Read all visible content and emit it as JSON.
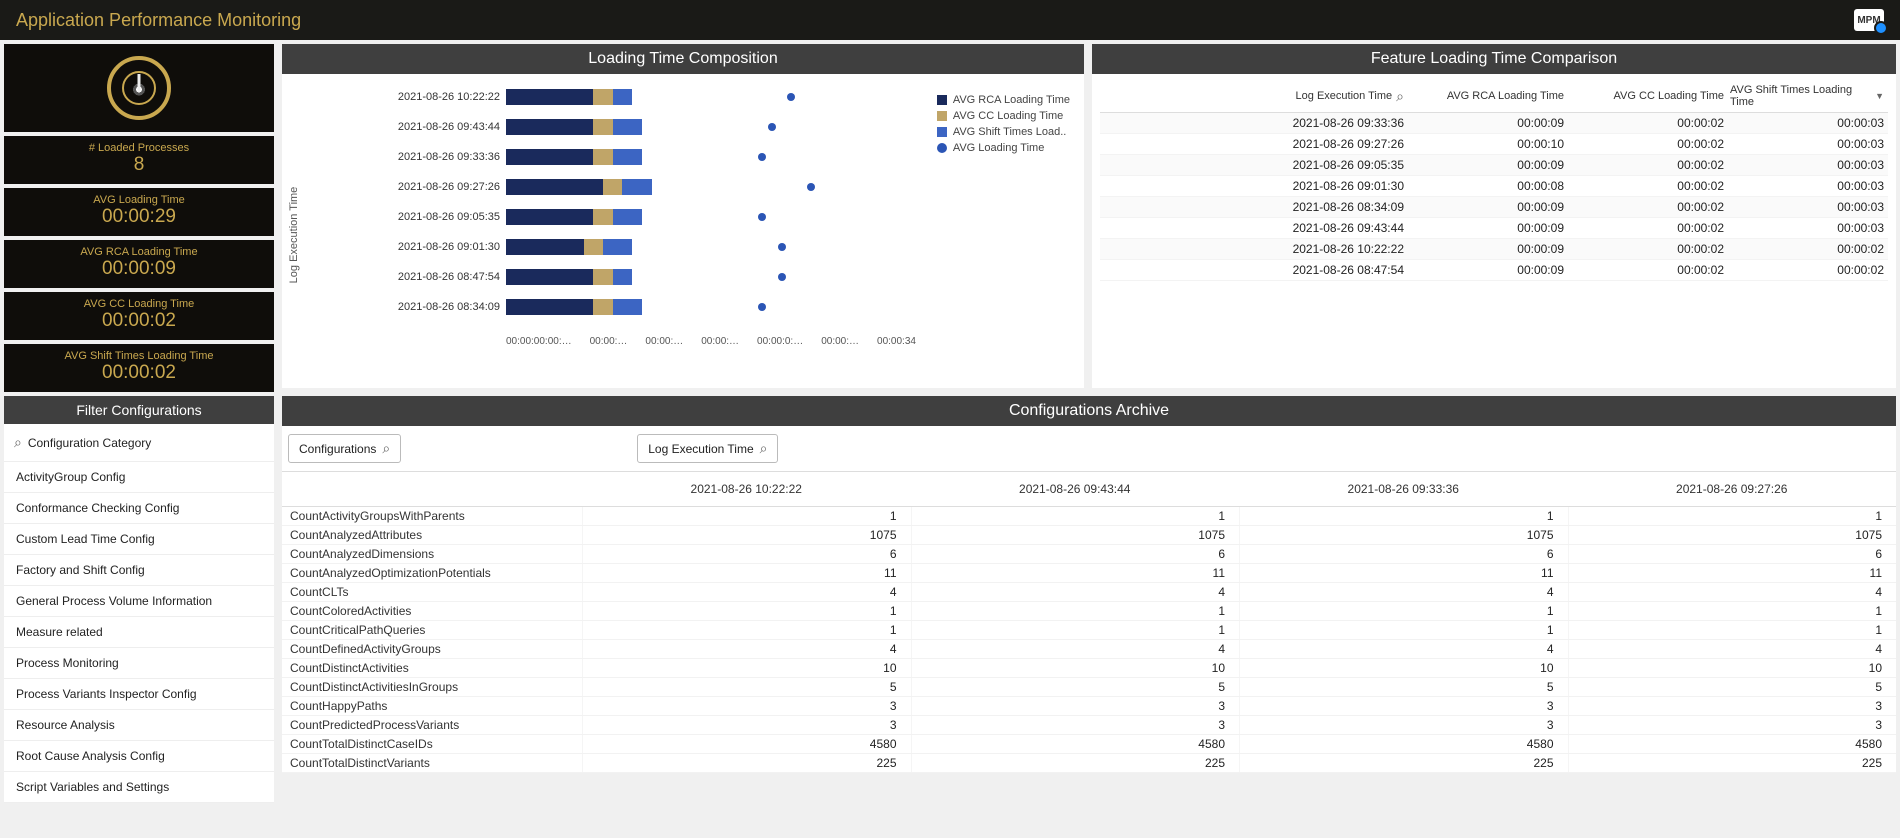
{
  "header": {
    "title": "Application Performance Monitoring",
    "logo_text": "MPM"
  },
  "kpis": [
    {
      "label": "# Loaded Processes",
      "value": "8"
    },
    {
      "label": "AVG Loading Time",
      "value": "00:00:29"
    },
    {
      "label": "AVG RCA Loading Time",
      "value": "00:00:09"
    },
    {
      "label": "AVG CC Loading Time",
      "value": "00:00:02"
    },
    {
      "label": "AVG Shift Times Loading Time",
      "value": "00:00:02"
    }
  ],
  "chart_panel": {
    "title": "Loading Time Composition",
    "y_axis": "Log Execution Time",
    "legend": [
      {
        "label": "AVG   RCA Loading Time",
        "color": "#1a2a5c"
      },
      {
        "label": "AVG   CC Loading Time",
        "color": "#c0a568"
      },
      {
        "label": "AVG   Shift Times Load..",
        "color": "#3c65c3"
      },
      {
        "label": "AVG   Loading Time",
        "shape": "dot",
        "color": "#2b55b5"
      }
    ],
    "x_ticks": [
      "00:00:00:00:…",
      "00:00:…",
      "00:00:…",
      "00:00:…",
      "00:00:0:…",
      "00:00:…",
      "00:00:34"
    ]
  },
  "chart_data": {
    "type": "bar",
    "orientation": "horizontal",
    "stacked": true,
    "y_axis_label": "Log Execution Time",
    "x_axis_label": "",
    "xlim": [
      "00:00:00",
      "00:00:34"
    ],
    "categories": [
      "2021-08-26 10:22:22",
      "2021-08-26 09:43:44",
      "2021-08-26 09:33:36",
      "2021-08-26 09:27:26",
      "2021-08-26 09:05:35",
      "2021-08-26 09:01:30",
      "2021-08-26 08:47:54",
      "2021-08-26 08:34:09"
    ],
    "series": [
      {
        "name": "AVG RCA Loading Time",
        "color": "#1a2a5c",
        "values_seconds": [
          9,
          9,
          9,
          10,
          9,
          8,
          9,
          9
        ]
      },
      {
        "name": "AVG CC Loading Time",
        "color": "#c0a568",
        "values_seconds": [
          2,
          2,
          2,
          2,
          2,
          2,
          2,
          2
        ]
      },
      {
        "name": "AVG Shift Times Loading Time",
        "color": "#3c65c3",
        "values_seconds": [
          2,
          3,
          3,
          3,
          3,
          3,
          2,
          3
        ]
      }
    ],
    "point_series": {
      "name": "AVG Loading Time",
      "color": "#2b55b5",
      "values_seconds": [
        29,
        27,
        26,
        31,
        26,
        28,
        28,
        26
      ]
    }
  },
  "feature_table": {
    "title": "Feature Loading Time Comparison",
    "columns": [
      "Log Execution Time",
      "AVG RCA Loading Time",
      "AVG CC Loading Time",
      "AVG Shift Times Loading Time"
    ],
    "sort_col": 3,
    "sort_dir": "desc",
    "rows": [
      [
        "2021-08-26 09:33:36",
        "00:00:09",
        "00:00:02",
        "00:00:03"
      ],
      [
        "2021-08-26 09:27:26",
        "00:00:10",
        "00:00:02",
        "00:00:03"
      ],
      [
        "2021-08-26 09:05:35",
        "00:00:09",
        "00:00:02",
        "00:00:03"
      ],
      [
        "2021-08-26 09:01:30",
        "00:00:08",
        "00:00:02",
        "00:00:03"
      ],
      [
        "2021-08-26 08:34:09",
        "00:00:09",
        "00:00:02",
        "00:00:03"
      ],
      [
        "2021-08-26 09:43:44",
        "00:00:09",
        "00:00:02",
        "00:00:03"
      ],
      [
        "2021-08-26 10:22:22",
        "00:00:09",
        "00:00:02",
        "00:00:02"
      ],
      [
        "2021-08-26 08:47:54",
        "00:00:09",
        "00:00:02",
        "00:00:02"
      ]
    ]
  },
  "sidebar": {
    "title": "Filter Configurations",
    "search_label": "Configuration Category",
    "items": [
      "ActivityGroup Config",
      "Conformance Checking Config",
      "Custom Lead Time Config",
      "Factory and Shift Config",
      "General Process Volume Information",
      "Measure related",
      "Process Monitoring",
      "Process Variants Inspector Config",
      "Resource Analysis",
      "Root Cause Analysis Config",
      "Script Variables and Settings"
    ]
  },
  "archive": {
    "title": "Configurations Archive",
    "filters": [
      "Configurations",
      "Log Execution Time"
    ],
    "columns": [
      "",
      "2021-08-26 10:22:22",
      "2021-08-26 09:43:44",
      "2021-08-26 09:33:36",
      "2021-08-26 09:27:26"
    ],
    "rows": [
      [
        "CountActivityGroupsWithParents",
        "1",
        "1",
        "1",
        "1"
      ],
      [
        "CountAnalyzedAttributes",
        "1075",
        "1075",
        "1075",
        "1075"
      ],
      [
        "CountAnalyzedDimensions",
        "6",
        "6",
        "6",
        "6"
      ],
      [
        "CountAnalyzedOptimizationPotentials",
        "11",
        "11",
        "11",
        "11"
      ],
      [
        "CountCLTs",
        "4",
        "4",
        "4",
        "4"
      ],
      [
        "CountColoredActivities",
        "1",
        "1",
        "1",
        "1"
      ],
      [
        "CountCriticalPathQueries",
        "1",
        "1",
        "1",
        "1"
      ],
      [
        "CountDefinedActivityGroups",
        "4",
        "4",
        "4",
        "4"
      ],
      [
        "CountDistinctActivities",
        "10",
        "10",
        "10",
        "10"
      ],
      [
        "CountDistinctActivitiesInGroups",
        "5",
        "5",
        "5",
        "5"
      ],
      [
        "CountHappyPaths",
        "3",
        "3",
        "3",
        "3"
      ],
      [
        "CountPredictedProcessVariants",
        "3",
        "3",
        "3",
        "3"
      ],
      [
        "CountTotalDistinctCaseIDs",
        "4580",
        "4580",
        "4580",
        "4580"
      ],
      [
        "CountTotalDistinctVariants",
        "225",
        "225",
        "225",
        "225"
      ]
    ]
  }
}
